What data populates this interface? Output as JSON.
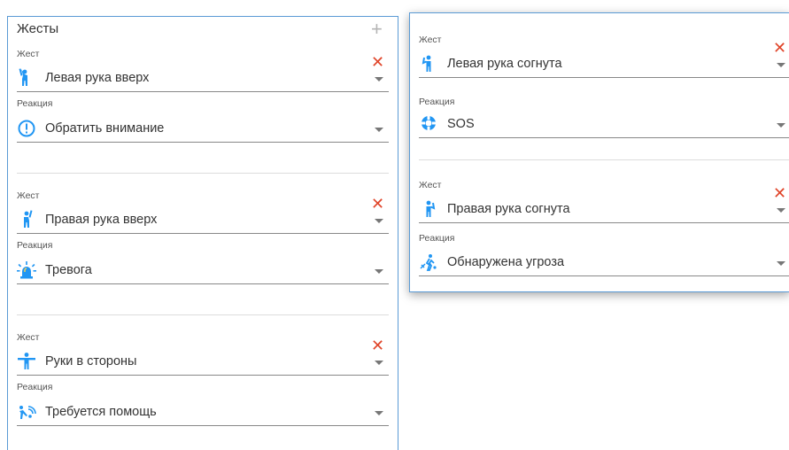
{
  "panel_title": "Жесты",
  "add_symbol": "+",
  "remove_symbol": "✕",
  "gesture_label": "Жест",
  "reaction_label": "Реакция",
  "accent_color": "#2196f3",
  "remove_color": "#e0452a",
  "left_groups": [
    {
      "gesture": "Левая рука вверх",
      "gesture_icon": "person-left-arm-up-icon",
      "reaction": "Обратить внимание",
      "reaction_icon": "exclamation-circle-icon"
    },
    {
      "gesture": "Правая рука вверх",
      "gesture_icon": "person-right-arm-up-icon",
      "reaction": "Тревога",
      "reaction_icon": "alarm-light-icon"
    },
    {
      "gesture": "Руки в стороны",
      "gesture_icon": "person-arms-out-icon",
      "reaction": "Требуется помощь",
      "reaction_icon": "help-signal-icon"
    }
  ],
  "right_groups": [
    {
      "gesture": "Левая рука согнута",
      "gesture_icon": "person-left-arm-bent-icon",
      "reaction": "SOS",
      "reaction_icon": "lifebuoy-icon"
    },
    {
      "gesture": "Правая рука согнута",
      "gesture_icon": "person-right-arm-bent-icon",
      "reaction": "Обнаружена угроза",
      "reaction_icon": "threat-person-icon"
    }
  ]
}
